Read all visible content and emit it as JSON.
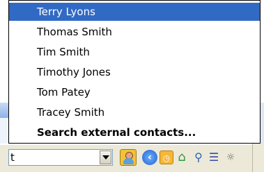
{
  "search": {
    "value": "t"
  },
  "suggestions": [
    {
      "label": "Terry Lyons",
      "selected": true
    },
    {
      "label": "Thomas Smith"
    },
    {
      "label": "Tim Smith"
    },
    {
      "label": "Timothy Jones"
    },
    {
      "label": "Tom Patey"
    },
    {
      "label": "Tracey Smith"
    },
    {
      "label": "Search external contacts...",
      "bold": true
    }
  ],
  "toolbar_icons": [
    "contact-icon",
    "back-icon",
    "clock-icon",
    "home-icon",
    "find-icon",
    "list-icon",
    "more-icon"
  ],
  "colors": {
    "selection": "#316ac5",
    "toolbar": "#ece9d8"
  }
}
